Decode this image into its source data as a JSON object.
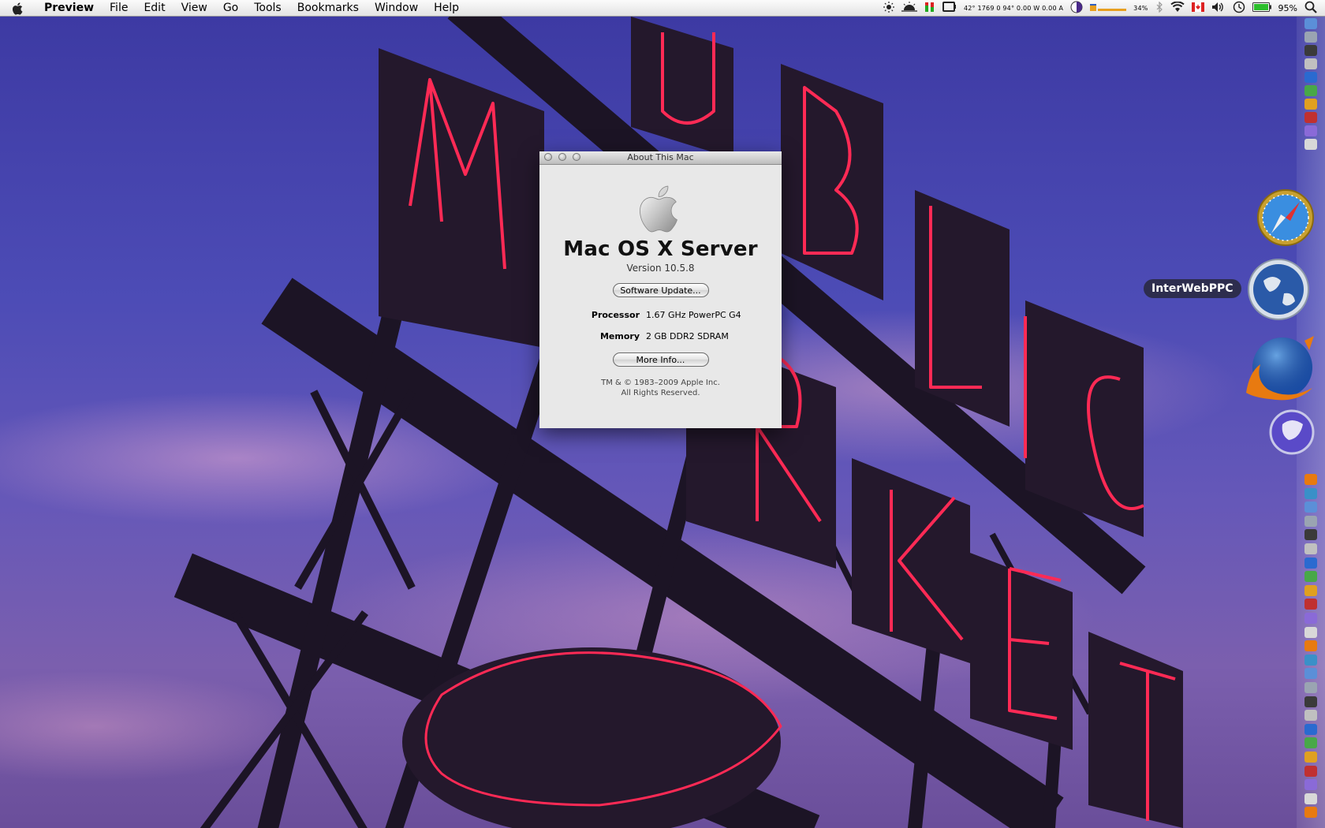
{
  "menubar": {
    "apple_icon": "apple-icon",
    "app_name": "Preview",
    "menus": [
      "File",
      "Edit",
      "View",
      "Go",
      "Tools",
      "Bookmarks",
      "Window",
      "Help"
    ],
    "stats_text": "42° 1769 0 94° 0.00 W 0.00 A",
    "disk_percent": "34%",
    "battery_percent": "95%",
    "status_icons": [
      "brightness-icon",
      "sun-eclipse-icon",
      "meter-icon",
      "display-icon",
      "half-moon-icon",
      "disk-bar-icon",
      "bluetooth-icon",
      "wifi-icon",
      "canada-flag-icon",
      "volume-icon",
      "clock-icon",
      "battery-icon",
      "spotlight-icon"
    ]
  },
  "about_window": {
    "title": "About This Mac",
    "logo_icon": "apple-logo-icon",
    "os_name": "Mac OS X Server",
    "version": "Version 10.5.8",
    "software_update_label": "Software Update...",
    "processor_label": "Processor",
    "processor_value": "1.67 GHz PowerPC G4",
    "memory_label": "Memory",
    "memory_value": "2 GB DDR2 SDRAM",
    "more_info_label": "More Info...",
    "copyright_line1": "TM & © 1983–2009 Apple Inc.",
    "copyright_line2": "All Rights Reserved."
  },
  "dock": {
    "tooltip": "InterWebPPC",
    "large_icons": [
      "safari-icon",
      "interwebppc-globe-icon",
      "firefox-icon",
      "camino-icon"
    ],
    "colors": {
      "accent": "#2a60c8"
    }
  }
}
